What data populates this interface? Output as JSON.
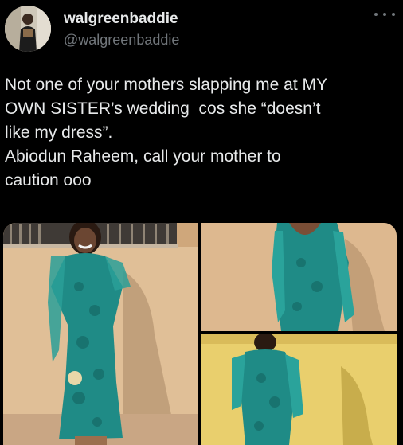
{
  "user": {
    "display_name": "walgreenbaddie",
    "handle": "@walgreenbaddie"
  },
  "tweet": {
    "lines": [
      "Not one of your mothers slapping me at MY",
      "OWN SISTER’s wedding  cos she “doesn’t",
      "like my dress”.",
      "Abiodun Raheem, call your mother to",
      "caution ooo"
    ]
  },
  "icons": {
    "more": "more-horizontal-icon"
  },
  "colors": {
    "background": "#000000",
    "text": "#e7e9ea",
    "secondary_text": "#71767b",
    "dress": "#1f8b86",
    "wall": "#e2c29b"
  },
  "media": {
    "count": 3
  }
}
